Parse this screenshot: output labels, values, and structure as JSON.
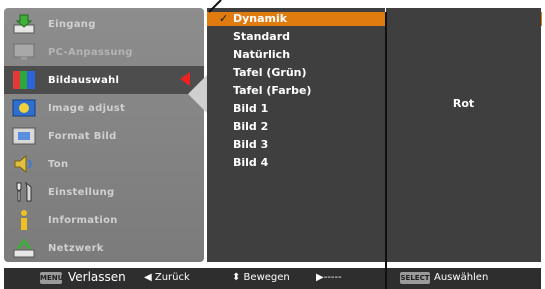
{
  "menu": {
    "items": [
      {
        "label": "Eingang",
        "icon": "input-icon"
      },
      {
        "label": "PC-Anpassung",
        "icon": "pc-adjust-icon"
      },
      {
        "label": "Bildauswahl",
        "icon": "image-select-icon"
      },
      {
        "label": "Image adjust",
        "icon": "image-adjust-icon"
      },
      {
        "label": "Format Bild",
        "icon": "screen-format-icon"
      },
      {
        "label": "Ton",
        "icon": "speaker-icon"
      },
      {
        "label": "Einstellung",
        "icon": "settings-icon"
      },
      {
        "label": "Information",
        "icon": "info-icon"
      },
      {
        "label": "Netzwerk",
        "icon": "network-icon"
      }
    ],
    "selected_index": 2
  },
  "options": {
    "items": [
      "Dynamik",
      "Standard",
      "Natürlich",
      "Tafel (Grün)",
      "Tafel (Farbe)",
      "Bild 1",
      "Bild 2",
      "Bild 3",
      "Bild 4"
    ],
    "active_index": 0,
    "check_mark": "✓"
  },
  "value_panel": {
    "value": "Rot"
  },
  "status_bar": {
    "menu_key": "MENU",
    "exit_label": "Verlassen",
    "back_label": "◀ Zurück",
    "move_label": "⬍ Bewegen",
    "next_label": "▶-----",
    "select_key": "SELECT",
    "select_label": "Auswählen"
  },
  "colors": {
    "highlight": "#e07b10",
    "panel": "#3f3f3f",
    "menu": "#888888",
    "selected_menu": "#4d4d4d",
    "arrow": "#ee2222"
  }
}
